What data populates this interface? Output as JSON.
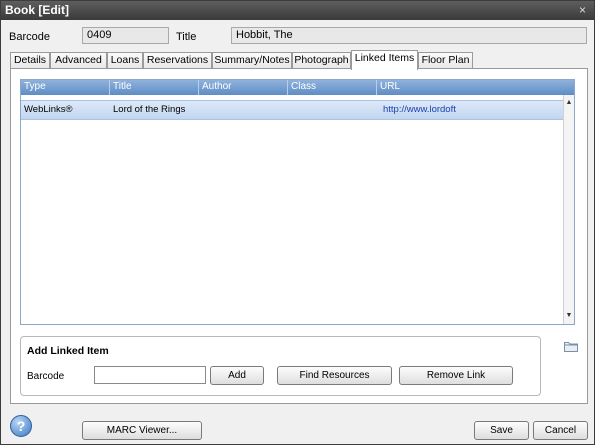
{
  "window": {
    "title": "Book [Edit]",
    "close_glyph": "×"
  },
  "fields": {
    "barcode_label": "Barcode",
    "barcode_value": "0409",
    "title_label": "Title",
    "title_value": "Hobbit, The"
  },
  "tabs": [
    {
      "label": "Details",
      "active": false
    },
    {
      "label": "Advanced",
      "active": false
    },
    {
      "label": "Loans",
      "active": false
    },
    {
      "label": "Reservations",
      "active": false
    },
    {
      "label": "Summary/Notes",
      "active": false
    },
    {
      "label": "Photograph",
      "active": false
    },
    {
      "label": "Linked Items",
      "active": true
    },
    {
      "label": "Floor Plan",
      "active": false
    }
  ],
  "grid": {
    "columns": [
      "Type",
      "Title",
      "Author",
      "Class",
      "URL"
    ],
    "rows": [
      {
        "type": "WebLinks®",
        "title": "Lord of the Rings",
        "author": "",
        "class": "",
        "url": "http://www.lordoft"
      }
    ],
    "scroll_up_icon": "▲",
    "scroll_down_icon": "▼"
  },
  "add_linked_item": {
    "heading": "Add Linked Item",
    "barcode_label": "Barcode",
    "barcode_input_value": "",
    "add_button": "Add",
    "find_button": "Find Resources",
    "remove_button": "Remove Link"
  },
  "footer": {
    "help_glyph": "?",
    "marc_button": "MARC Viewer...",
    "save_button": "Save",
    "cancel_button": "Cancel"
  },
  "colors": {
    "header_blue": "#6f98cf",
    "selected_row": "#cddff5",
    "url_link": "#1a3fb0"
  }
}
